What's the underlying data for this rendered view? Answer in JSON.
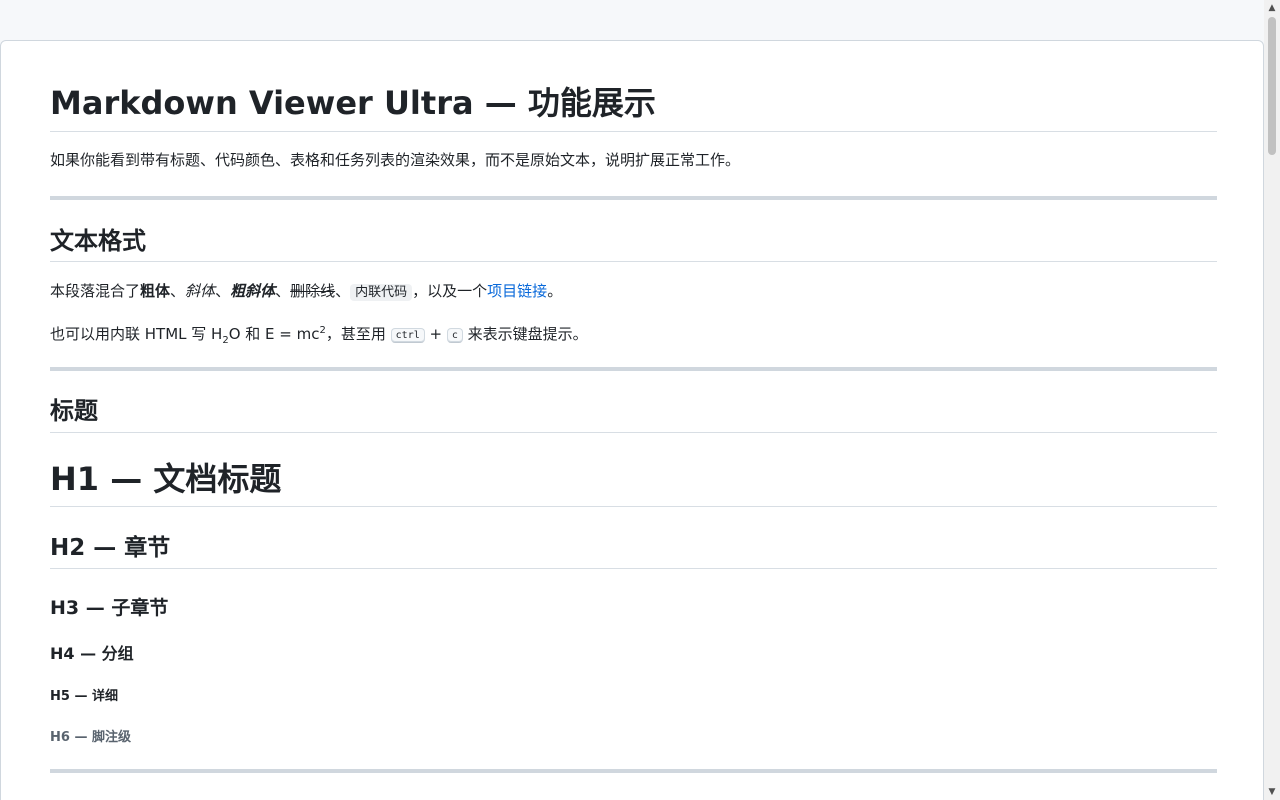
{
  "doc": {
    "title": "Markdown Viewer Ultra — 功能展示",
    "intro": "如果你能看到带有标题、代码颜色、表格和任务列表的渲染效果，而不是原始文本，说明扩展正常工作。"
  },
  "text_format": {
    "heading": "文本格式",
    "p1": {
      "prefix": "本段落混合了",
      "bold": "粗体",
      "sep1": "、",
      "italic": "斜体",
      "sep2": "、",
      "bold_italic": "粗斜体",
      "sep3": "、",
      "strike": "删除线",
      "sep4": "、",
      "code": "内联代码",
      "mid": "，以及一个",
      "link": "项目链接",
      "end": "。"
    },
    "p2": {
      "prefix": "也可以用内联 HTML 写 H",
      "sub": "2",
      "mid1": "O 和 E = mc",
      "sup": "2",
      "mid2": "，甚至用 ",
      "kbd1": "ctrl",
      "plus": " + ",
      "kbd2": "c",
      "end": " 来表示键盘提示。"
    }
  },
  "headings": {
    "heading": "标题",
    "h1": "H1 — 文档标题",
    "h2": "H2 — 章节",
    "h3": "H3 — 子章节",
    "h4": "H4 — 分组",
    "h5": "H5 — 详细",
    "h6": "H6 — 脚注级"
  },
  "scrollbar": {
    "up_icon": "triangle-up-icon",
    "down_icon": "triangle-down-icon"
  }
}
